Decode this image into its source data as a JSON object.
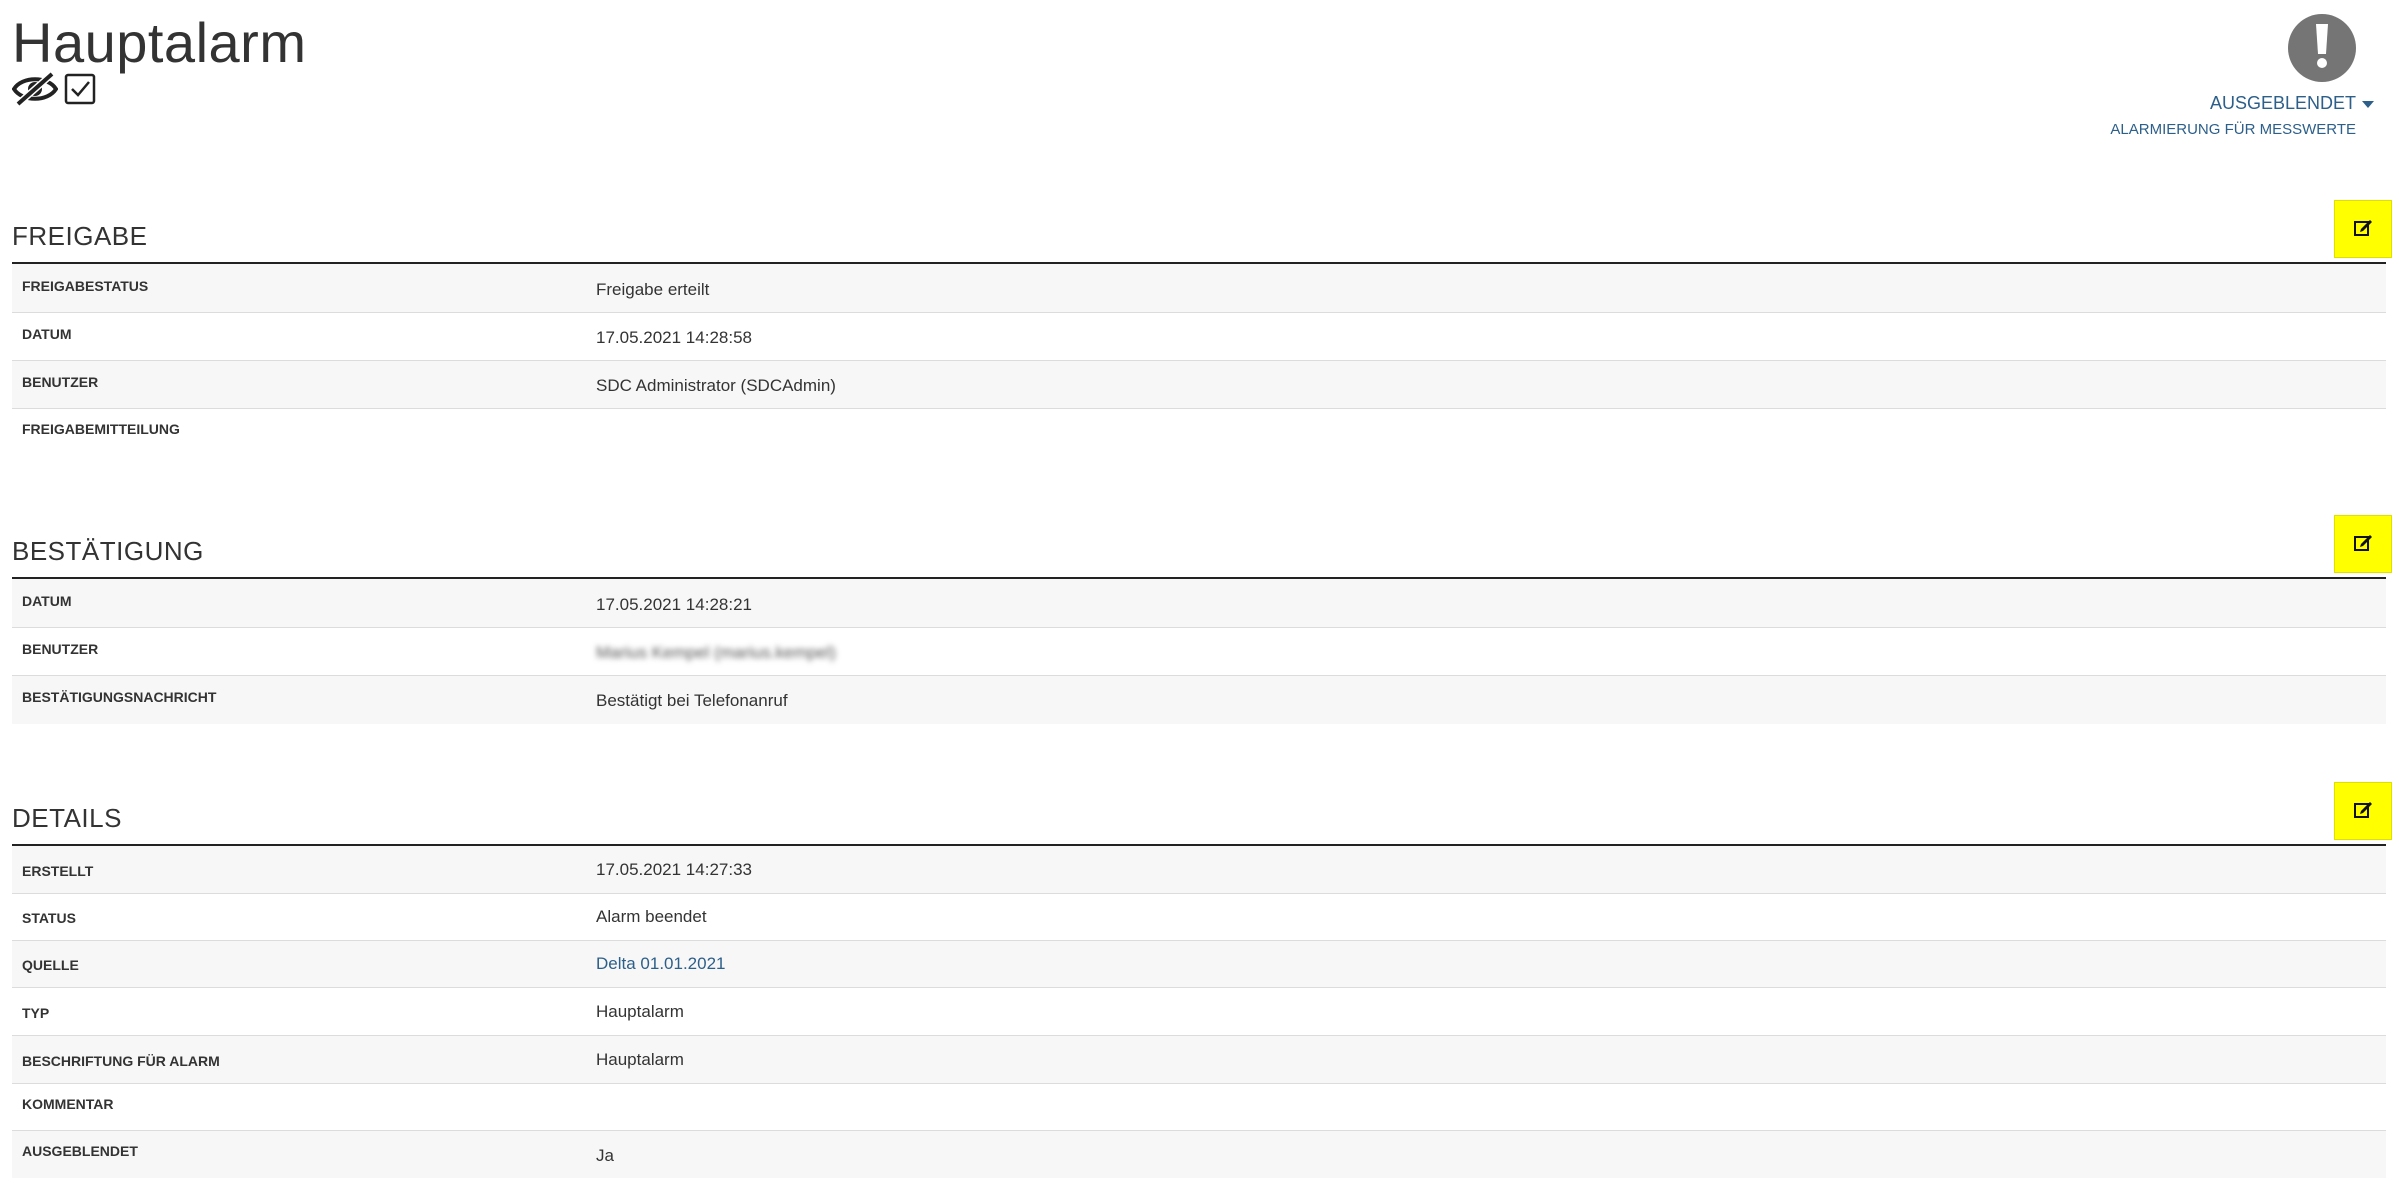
{
  "page": {
    "title": "Hauptalarm",
    "status_label": "AUSGEBLENDET",
    "status_sub": "ALARMIERUNG FÜR MESSWERTE",
    "icons": [
      "eye-slash-icon",
      "checkbox-checked-icon",
      "exclamation-icon",
      "caret-down-icon",
      "edit-icon"
    ]
  },
  "colors": {
    "edit_button": "#ffff00",
    "link": "#2c5f8a",
    "alert_circle": "#757575"
  },
  "freigabe": {
    "title": "FREIGABE",
    "rows": [
      {
        "label": "FREIGABESTATUS",
        "value": "Freigabe erteilt"
      },
      {
        "label": "DATUM",
        "value": "17.05.2021 14:28:58"
      },
      {
        "label": "BENUTZER",
        "value": "SDC Administrator (SDCAdmin)"
      },
      {
        "label": "FREIGABEMITTEILUNG",
        "value": ""
      }
    ]
  },
  "bestaetigung": {
    "title": "BESTÄTIGUNG",
    "rows": [
      {
        "label": "DATUM",
        "value": "17.05.2021 14:28:21"
      },
      {
        "label": "BENUTZER",
        "value": "Marius Kempel (marius.kempel)"
      },
      {
        "label": "BESTÄTIGUNGSNACHRICHT",
        "value": "Bestätigt bei Telefonanruf"
      }
    ]
  },
  "details": {
    "title": "DETAILS",
    "rows": [
      {
        "label": "ERSTELLT",
        "value": "17.05.2021 14:27:33"
      },
      {
        "label": "STATUS",
        "value": "Alarm beendet"
      },
      {
        "label": "QUELLE",
        "value": "Delta 01.01.2021"
      },
      {
        "label": "TYP",
        "value": "Hauptalarm"
      },
      {
        "label": "BESCHRIFTUNG FÜR ALARM",
        "value": "Hauptalarm"
      },
      {
        "label": "KOMMENTAR",
        "value": ""
      },
      {
        "label": "AUSGEBLENDET",
        "value": "Ja"
      }
    ]
  }
}
